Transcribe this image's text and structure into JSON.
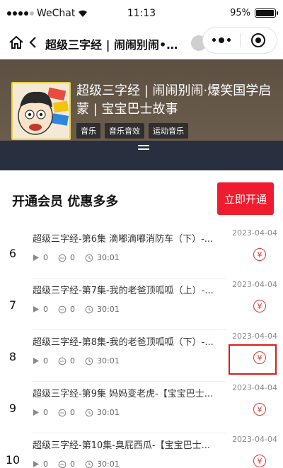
{
  "status_bar": {
    "carrier": "WeChat",
    "time": "11:13",
    "battery": "95%",
    "battery_level": 0.95
  },
  "nav": {
    "title": "超级三字经 | 闹闹别闹•爆..."
  },
  "album": {
    "title": "超级三字经 | 闹闹别闹·爆笑国学启蒙 | 宝宝巴士故事",
    "tags": [
      "音乐",
      "音乐音效",
      "运动音乐"
    ]
  },
  "vip": {
    "text": "开通会员 优惠多多",
    "button": "立即开通"
  },
  "tracks": [
    {
      "num": "6",
      "title": "超级三字经-第6集 滴嘟滴嘟消防车（下）-...",
      "plays": "0",
      "comments": "0",
      "duration": "30:01",
      "date": "2023-04-04",
      "price_icon": "¥"
    },
    {
      "num": "7",
      "title": "超级三字经-第7集-我的老爸顶呱呱（上）-...",
      "plays": "0",
      "comments": "0",
      "duration": "30:01",
      "date": "2023-04-04",
      "price_icon": "¥"
    },
    {
      "num": "8",
      "title": "超级三字经-第8集-我的老爸顶呱呱（下）-...",
      "plays": "0",
      "comments": "0",
      "duration": "30:01",
      "date": "2023-04-04",
      "price_icon": "¥"
    },
    {
      "num": "9",
      "title": "超级三字经-第9集 妈妈变老虎-【宝宝巴士...",
      "plays": "0",
      "comments": "0",
      "duration": "30:01",
      "date": "2023-04-04",
      "price_icon": "¥"
    },
    {
      "num": "10",
      "title": "超级三字经-第10集-臭屁西瓜-【宝宝巴士...",
      "plays": "0",
      "comments": "0",
      "duration": "30:01",
      "date": "2023-04-04",
      "price_icon": "¥"
    }
  ],
  "colors": {
    "accent_red": "#ee1c2e",
    "header_brown": "#5c5042",
    "collapse_bar": "#2a2f3f"
  }
}
